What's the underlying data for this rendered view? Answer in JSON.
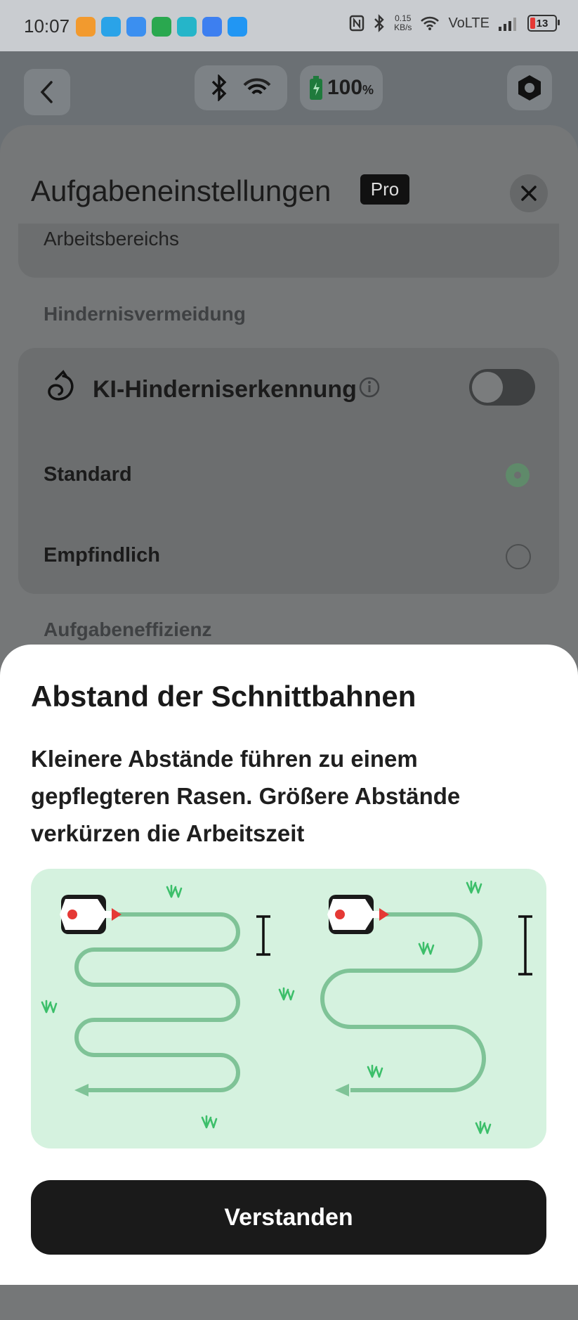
{
  "status_bar": {
    "time": "10:07",
    "net_speed_value": "0.15",
    "net_speed_unit": "KB/s",
    "volte": "VoLTE",
    "battery": "13"
  },
  "top_bar": {
    "battery_percent": "100",
    "battery_unit": "%"
  },
  "sheet": {
    "title": "Aufgabeneinstellungen",
    "pro_badge": "Pro",
    "card_area_text": "Arbeitsbereichs",
    "section_obstacle": "Hindernisvermeidung",
    "ai_detection_label": "KI-Hinderniserkennung",
    "ai_detection_enabled": false,
    "options": [
      {
        "label": "Standard",
        "selected": true
      },
      {
        "label": "Empfindlich",
        "selected": false
      }
    ],
    "section_efficiency": "Aufgabeneffizienz"
  },
  "modal": {
    "title": "Abstand der Schnittbahnen",
    "description": "Kleinere Abstände führen zu einem gepflegteren Rasen. Größere Abstände verkürzen die Arbeitszeit",
    "confirm_button": "Verstanden"
  },
  "colors": {
    "accent_green": "#7fc397",
    "illustration_bg": "#d5f2df",
    "grass": "#3cbf6a",
    "arrow_red": "#e53935",
    "button_dark": "#1a1a1a"
  },
  "icons": [
    "back-icon",
    "bluetooth-icon",
    "wifi-icon",
    "battery-icon",
    "settings-hex-icon",
    "close-icon",
    "ki-obstacle-icon",
    "info-icon",
    "mower-icon",
    "grass-icon"
  ]
}
